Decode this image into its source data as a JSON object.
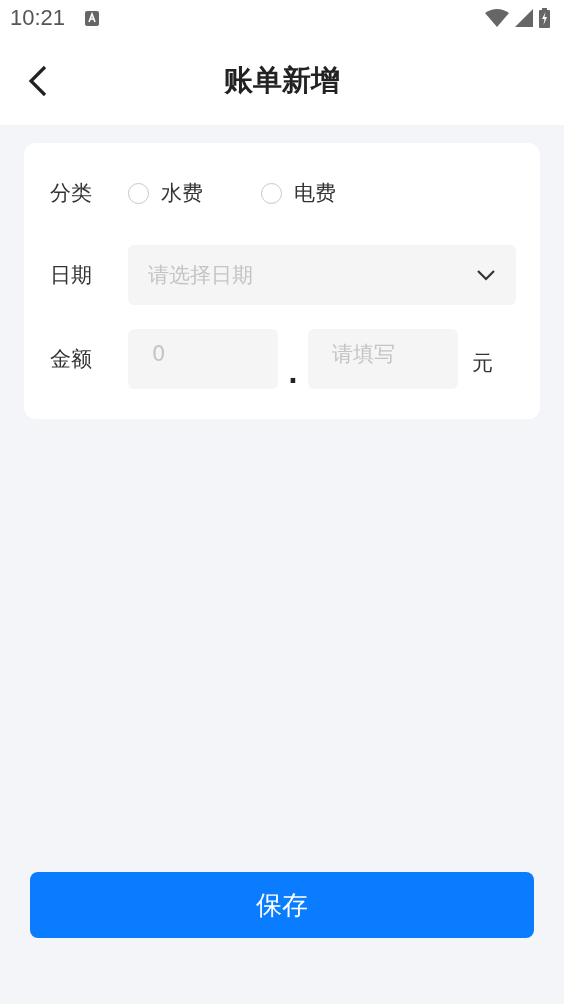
{
  "status_bar": {
    "time": "10:21"
  },
  "header": {
    "title": "账单新增"
  },
  "form": {
    "category": {
      "label": "分类",
      "options": [
        {
          "label": "水费",
          "selected": false
        },
        {
          "label": "电费",
          "selected": false
        }
      ]
    },
    "date": {
      "label": "日期",
      "placeholder": "请选择日期"
    },
    "amount": {
      "label": "金额",
      "integer_placeholder": "0",
      "separator": ".",
      "decimal_placeholder": "请填写",
      "unit": "元"
    }
  },
  "save_button": {
    "label": "保存"
  }
}
